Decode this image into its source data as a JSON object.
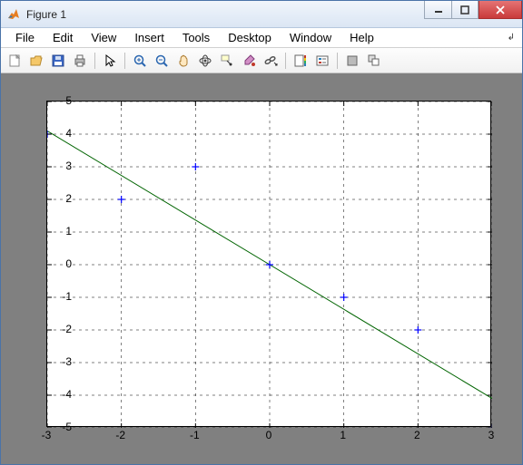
{
  "window": {
    "title": "Figure 1"
  },
  "menus": {
    "file": "File",
    "edit": "Edit",
    "view": "View",
    "insert": "Insert",
    "tools": "Tools",
    "desktop": "Desktop",
    "window": "Window",
    "help": "Help"
  },
  "toolbar": {
    "new": "new",
    "open": "open",
    "save": "save",
    "print": "print",
    "pointer": "pointer",
    "zoom_in": "zoom-in",
    "zoom_out": "zoom-out",
    "pan": "pan",
    "rotate": "rotate-3d",
    "data_cursor": "data-cursor",
    "brush": "brush",
    "link": "link",
    "colorbar": "colorbar",
    "legend": "legend",
    "hide": "hide-tools",
    "dock": "dock"
  },
  "chart_data": {
    "type": "scatter+line",
    "xlim": [
      -3,
      3
    ],
    "ylim": [
      -5,
      5
    ],
    "xticks": [
      -3,
      -2,
      -1,
      0,
      1,
      2,
      3
    ],
    "yticks": [
      -5,
      -4,
      -3,
      -2,
      -1,
      0,
      1,
      2,
      3,
      4,
      5
    ],
    "grid": true,
    "scatter": {
      "x": [
        -3,
        -2,
        -1,
        0,
        1,
        2,
        3
      ],
      "y": [
        4,
        2,
        3,
        0,
        -1,
        -2,
        -5
      ],
      "marker": "+",
      "color": "#0000ff"
    },
    "line": {
      "x": [
        -3,
        3
      ],
      "y": [
        4.1,
        -4.1
      ],
      "color": "#006400"
    },
    "title": "",
    "xlabel": "",
    "ylabel": ""
  }
}
